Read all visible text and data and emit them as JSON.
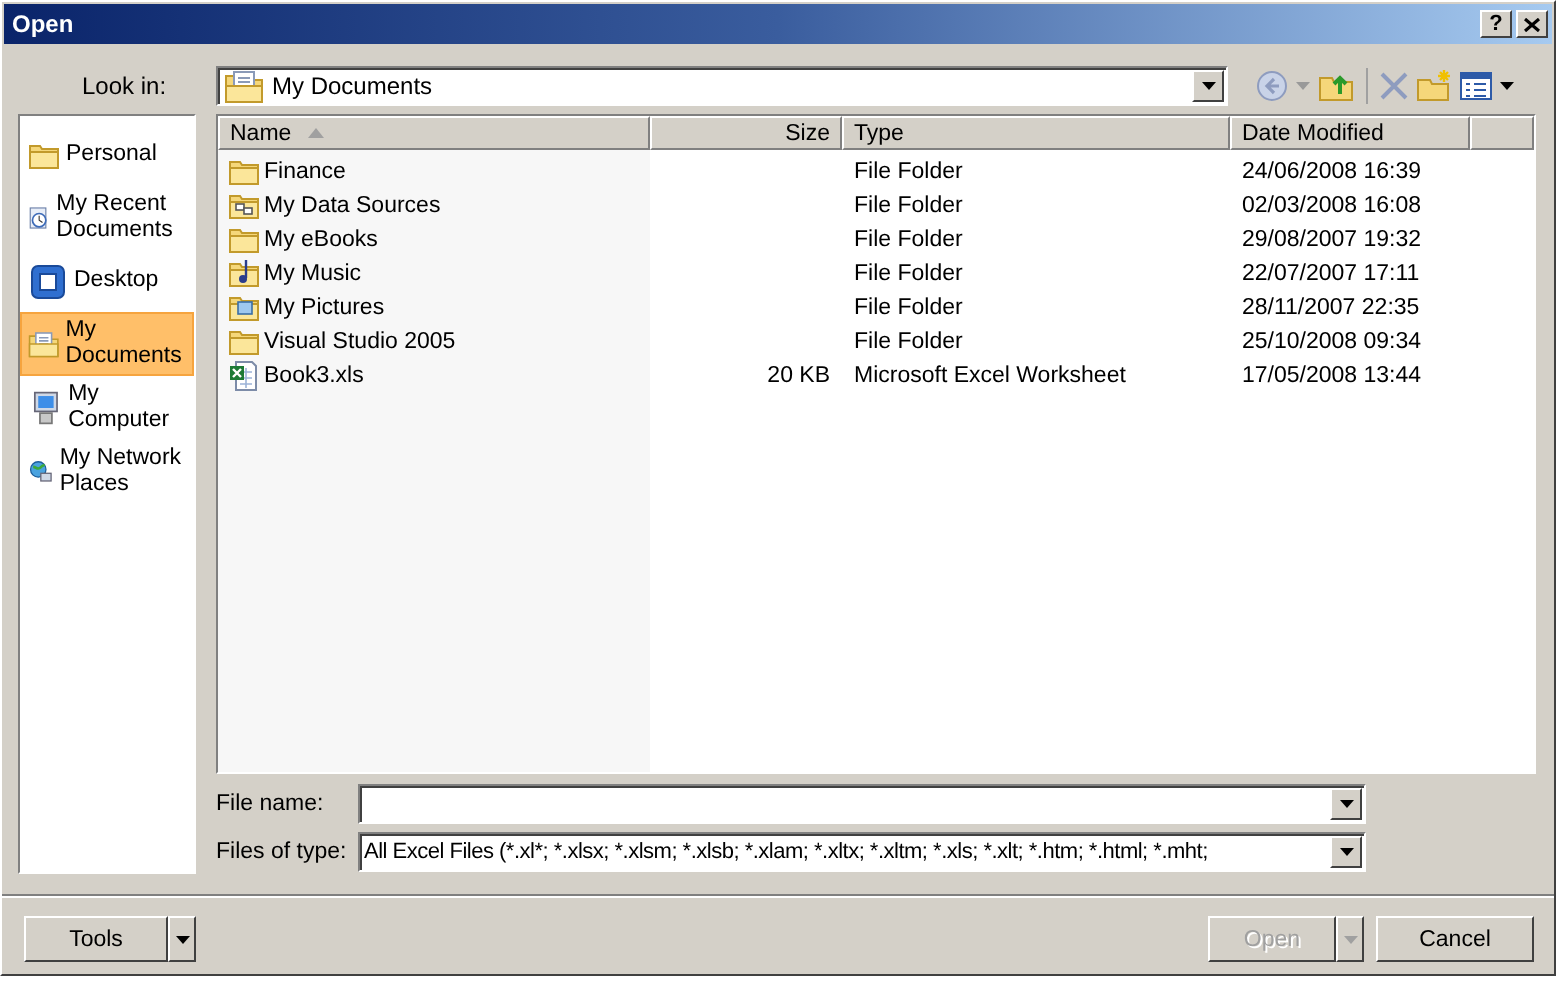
{
  "window": {
    "title": "Open",
    "help": "?"
  },
  "look_in": {
    "label": "Look in:",
    "value": "My Documents"
  },
  "places": [
    {
      "label": "Personal",
      "kind": "personal",
      "selected": false
    },
    {
      "label": "My Recent Documents",
      "kind": "recent",
      "selected": false
    },
    {
      "label": "Desktop",
      "kind": "desktop",
      "selected": false
    },
    {
      "label": "My Documents",
      "kind": "documents",
      "selected": true
    },
    {
      "label": "My Computer",
      "kind": "computer",
      "selected": false
    },
    {
      "label": "My Network Places",
      "kind": "network",
      "selected": false
    }
  ],
  "file_list": {
    "columns": [
      {
        "label": "Name",
        "sorted": true
      },
      {
        "label": "Size",
        "sorted": false
      },
      {
        "label": "Type",
        "sorted": false
      },
      {
        "label": "Date Modified",
        "sorted": false
      }
    ],
    "rows": [
      {
        "name": "Finance",
        "kind": "folder",
        "type": "File Folder",
        "date": "24/06/2008 16:39"
      },
      {
        "name": "My Data Sources",
        "kind": "data",
        "type": "File Folder",
        "date": "02/03/2008 16:08"
      },
      {
        "name": "My eBooks",
        "kind": "folder",
        "type": "File Folder",
        "date": "29/08/2007 19:32"
      },
      {
        "name": "My Music",
        "kind": "music",
        "type": "File Folder",
        "date": "22/07/2007 17:11"
      },
      {
        "name": "My Pictures",
        "kind": "pictures",
        "type": "File Folder",
        "date": "28/11/2007 22:35"
      },
      {
        "name": "Visual Studio 2005",
        "kind": "folder",
        "type": "File Folder",
        "date": "25/10/2008 09:34"
      },
      {
        "name": "Book3.xls",
        "kind": "excel",
        "size": "20 KB",
        "type": "Microsoft Excel Worksheet",
        "date": "17/05/2008 13:44"
      }
    ]
  },
  "file_name": {
    "label": "File name:"
  },
  "file_type": {
    "label": "Files of type:",
    "value": "All Excel Files (*.xl*; *.xlsx; *.xlsm; *.xlsb; *.xlam; *.xltx; *.xltm; *.xls; *.xlt; *.htm; *.html; *.mht;"
  },
  "buttons": {
    "tools": "Tools",
    "open": {
      "label": "Open",
      "disabled": true
    },
    "cancel": "Cancel"
  }
}
